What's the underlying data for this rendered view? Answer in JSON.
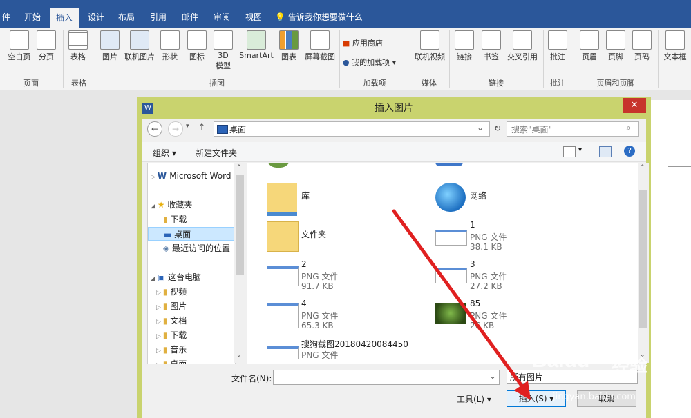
{
  "ribbon": {
    "tabs": [
      "件",
      "开始",
      "插入",
      "设计",
      "布局",
      "引用",
      "邮件",
      "审阅",
      "视图"
    ],
    "tellme": "告诉我你想要做什么",
    "buttons": {
      "blank_page": "空白页",
      "page_break": "分页",
      "table": "表格",
      "picture": "图片",
      "online_picture": "联机图片",
      "shapes": "形状",
      "icons": "图标",
      "model_3d_line1": "3D",
      "model_3d_line2": "模型",
      "smartart": "SmartArt",
      "chart": "图表",
      "screenshot": "屏幕截图",
      "store": "应用商店",
      "my_addins": "我的加载项",
      "online_video": "联机视频",
      "link": "链接",
      "bookmark": "书签",
      "cross_ref": "交叉引用",
      "comment": "批注",
      "header": "页眉",
      "footer": "页脚",
      "page_number": "页码",
      "text_box": "文本框"
    },
    "groups": {
      "pages": "页面",
      "tables": "表格",
      "illustrations": "插图",
      "addins": "加载项",
      "media": "媒体",
      "links": "链接",
      "comments": "批注",
      "header_footer": "页眉和页脚"
    }
  },
  "dialog": {
    "title": "插入图片",
    "close": "✕",
    "address": "桌面",
    "search_placeholder": "搜索\"桌面\"",
    "organize": "组织 ▾",
    "new_folder": "新建文件夹",
    "tree": [
      {
        "label": "Microsoft Word"
      },
      {
        "label": "收藏夹"
      },
      {
        "label": "下载"
      },
      {
        "label": "桌面"
      },
      {
        "label": "最近访问的位置"
      },
      {
        "label": "这台电脑"
      },
      {
        "label": "视频"
      },
      {
        "label": "图片"
      },
      {
        "label": "文档"
      },
      {
        "label": "下载"
      },
      {
        "label": "音乐"
      },
      {
        "label": "桌面"
      }
    ],
    "files": [
      {
        "name": "库",
        "type": "",
        "size": ""
      },
      {
        "name": "网络",
        "type": "",
        "size": ""
      },
      {
        "name": "文件夹",
        "type": "",
        "size": ""
      },
      {
        "name": "1",
        "type": "PNG 文件",
        "size": "38.1 KB"
      },
      {
        "name": "2",
        "type": "PNG 文件",
        "size": "91.7 KB"
      },
      {
        "name": "3",
        "type": "PNG 文件",
        "size": "27.2 KB"
      },
      {
        "name": "4",
        "type": "PNG 文件",
        "size": "65.3 KB"
      },
      {
        "name": "85",
        "type": "PNG 文件",
        "size": "26 KB"
      },
      {
        "name": "搜狗截图20180420084450",
        "type": "PNG 文件",
        "size": ""
      }
    ],
    "filename_label": "文件名(N):",
    "filename_value": "",
    "filetype": "所有图片",
    "tools": "工具(L)",
    "insert": "插入(S)",
    "cancel": "取消"
  },
  "watermark": {
    "brand": "Baidu",
    "brand_cn": "经验",
    "url": "jingyan.baidu.com"
  },
  "colors": {
    "ribbon_blue": "#2b579a",
    "dialog_frame": "#c9d36e",
    "close_red": "#c7342b",
    "arrow": "#e02020"
  }
}
